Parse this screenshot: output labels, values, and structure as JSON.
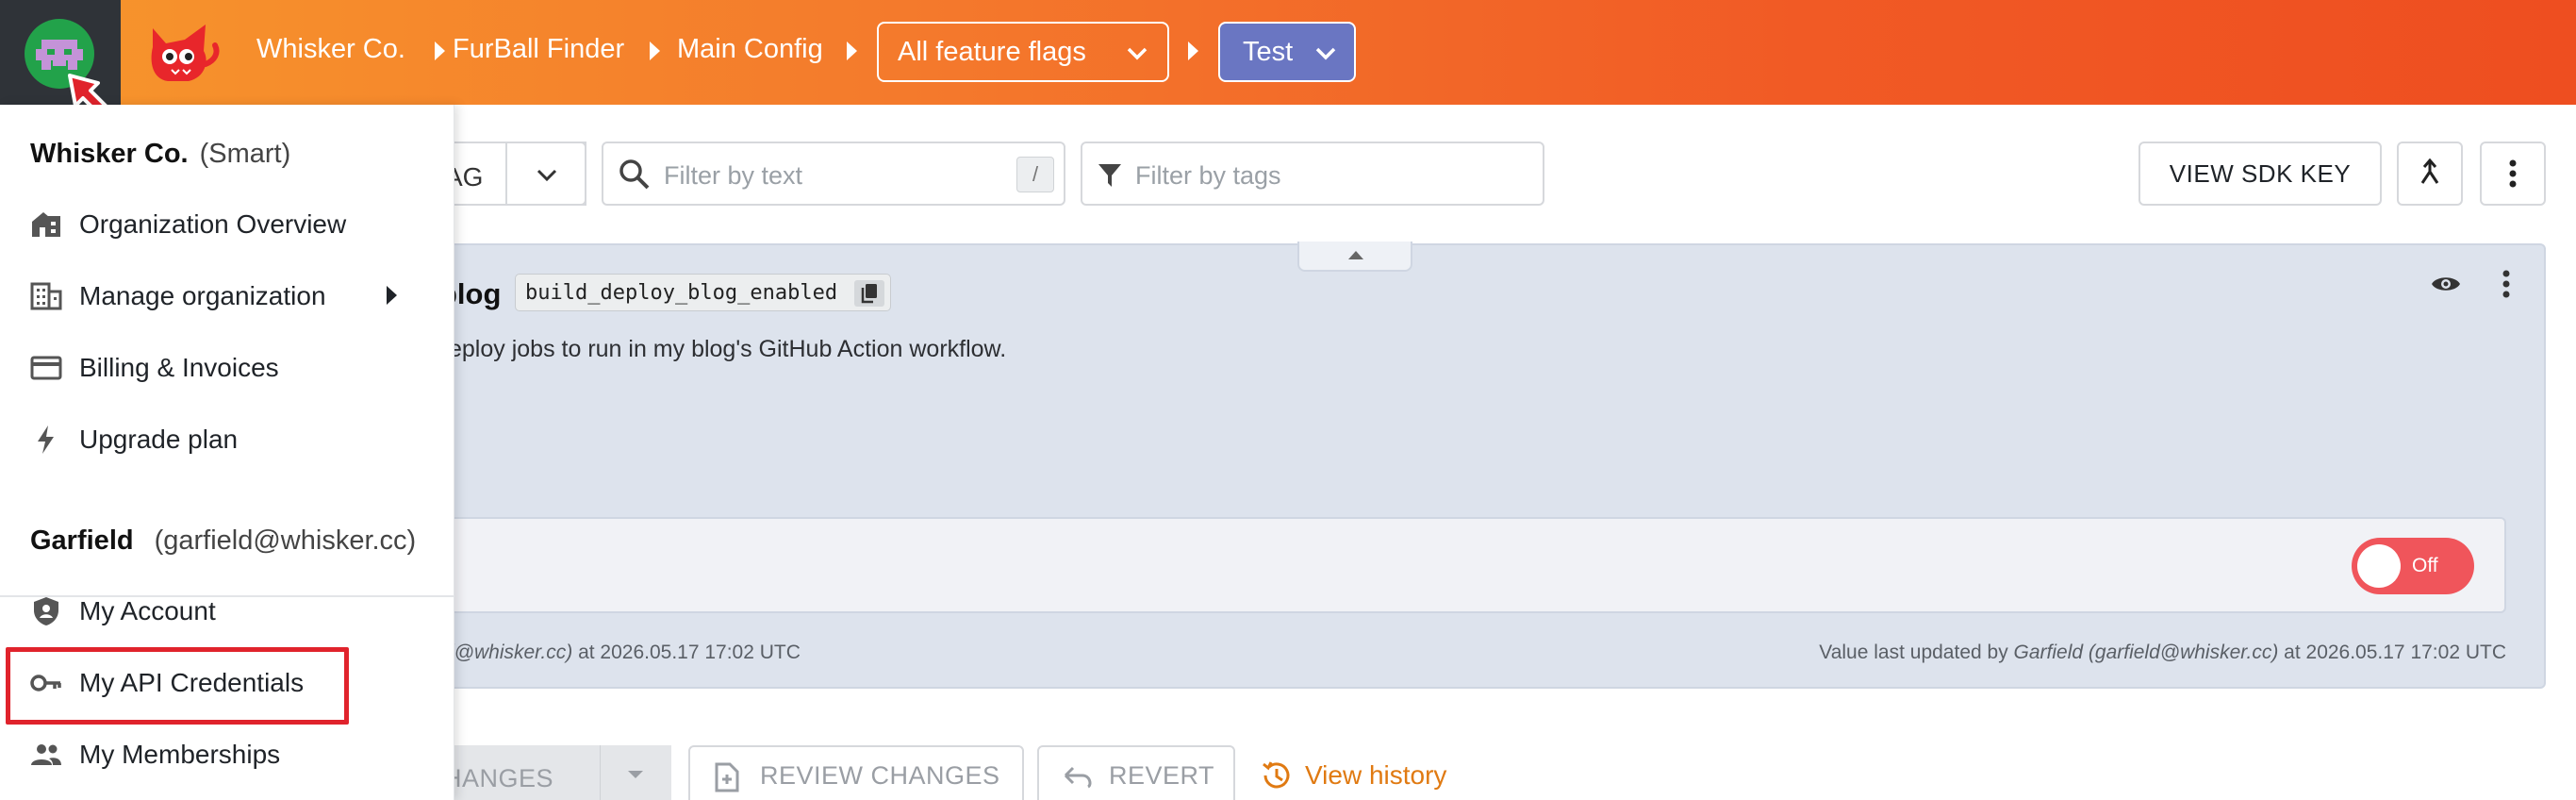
{
  "header": {
    "breadcrumbs": [
      "Whisker Co.",
      "FurBall Finder",
      "Main Config"
    ],
    "config_selector": "All feature flags",
    "environment": "Test",
    "colors": {
      "gradient_start": "#f7962c",
      "gradient_end": "#ee4e20",
      "environment_bg": "#6a76c2"
    }
  },
  "toolbar": {
    "add_flag_fragment": "AG",
    "filter_text_placeholder": "Filter by text",
    "filter_text_shortcut": "/",
    "filter_tags_placeholder": "Filter by tags",
    "view_sdk_key": "VIEW SDK KEY"
  },
  "flag": {
    "name_fragment": "blog",
    "key": "build_deploy_blog_enabled",
    "description_fragment": "eploy jobs to run in my blog's GitHub Action workflow.",
    "toggle_label": "Off",
    "toggle_on": false,
    "meta_left_user": "d@whisker.cc)",
    "meta_left_rest": " at 2026.05.17 17:02 UTC",
    "meta_right_prefix": "Value last updated by ",
    "meta_right_user": "Garfield (garfield@whisker.cc)",
    "meta_right_rest": " at 2026.05.17 17:02 UTC"
  },
  "actions": {
    "save_fragment": "HANGES",
    "review_changes": "REVIEW CHANGES",
    "revert": "REVERT",
    "view_history": "View history"
  },
  "menu": {
    "org_name": "Whisker Co.",
    "org_plan": "(Smart)",
    "org_items": [
      {
        "label": "Organization Overview",
        "icon": "building-home-icon"
      },
      {
        "label": "Manage organization",
        "icon": "office-building-icon",
        "has_submenu": true
      },
      {
        "label": "Billing & Invoices",
        "icon": "credit-card-icon"
      },
      {
        "label": "Upgrade plan",
        "icon": "lightning-icon"
      }
    ],
    "user_name": "Garfield",
    "user_email": "(garfield@whisker.cc)",
    "user_items": [
      {
        "label": "My Account",
        "icon": "shield-account-icon"
      },
      {
        "label": "My API Credentials",
        "icon": "key-icon",
        "highlighted": true
      },
      {
        "label": "My Memberships",
        "icon": "people-icon"
      }
    ],
    "highlight_color": "#e0232c"
  }
}
